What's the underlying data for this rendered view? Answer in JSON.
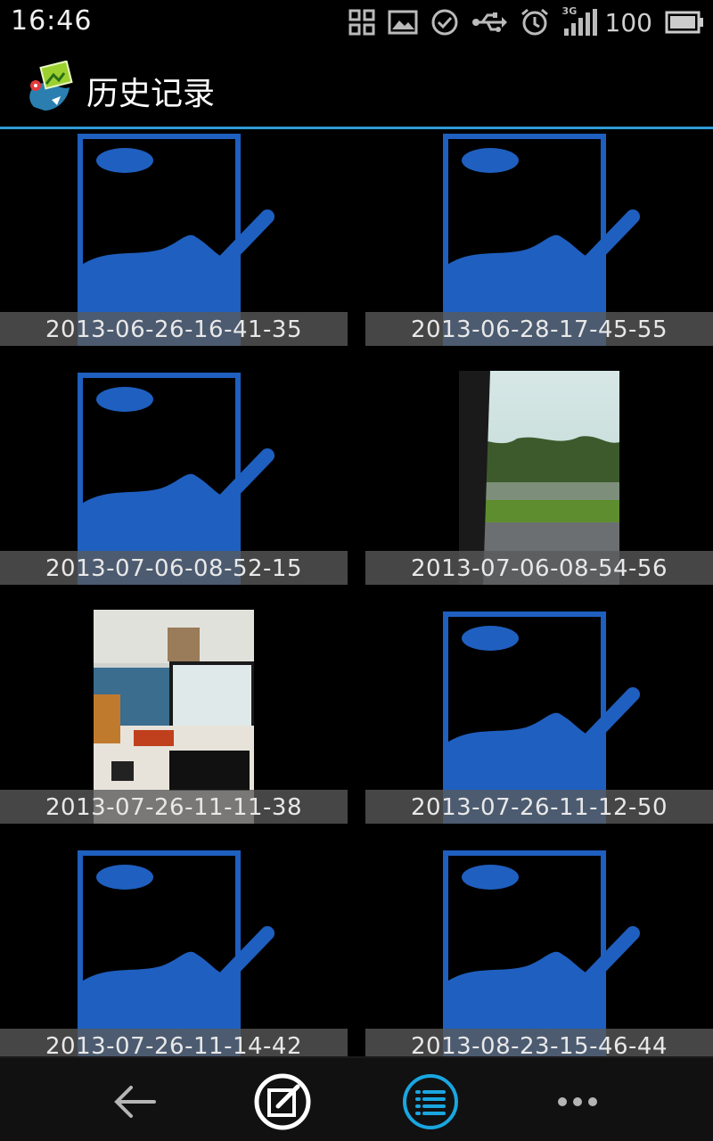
{
  "status_bar": {
    "time": "16:46",
    "network": "3G",
    "battery_level": "100",
    "icons": [
      "qr-scan-icon",
      "image-icon",
      "check-circle-icon",
      "usb-icon",
      "alarm-icon",
      "signal-3g-icon",
      "battery-icon"
    ]
  },
  "action_bar": {
    "title": "历史记录",
    "app_icon": "app-logo-icon"
  },
  "history_items": [
    {
      "label": "2013-06-26-16-41-35",
      "thumb": "placeholder-sketch"
    },
    {
      "label": "2013-06-28-17-45-55",
      "thumb": "placeholder-sketch"
    },
    {
      "label": "2013-07-06-08-52-15",
      "thumb": "placeholder-sketch"
    },
    {
      "label": "2013-07-06-08-54-56",
      "thumb": "photo-roadside"
    },
    {
      "label": "2013-07-26-11-11-38",
      "thumb": "photo-office-desk"
    },
    {
      "label": "2013-07-26-11-12-50",
      "thumb": "placeholder-sketch"
    },
    {
      "label": "2013-07-26-11-14-42",
      "thumb": "placeholder-sketch"
    },
    {
      "label": "2013-08-23-15-46-44",
      "thumb": "placeholder-sketch"
    }
  ],
  "bottom_bar": {
    "buttons": [
      "back-arrow-icon",
      "edit-icon",
      "list-icon",
      "more-icon"
    ],
    "active": "list-icon"
  },
  "colors": {
    "accent": "#2f9bd6",
    "placeholder_blue": "#1f5fbf",
    "list_active": "#1aa6e0"
  }
}
